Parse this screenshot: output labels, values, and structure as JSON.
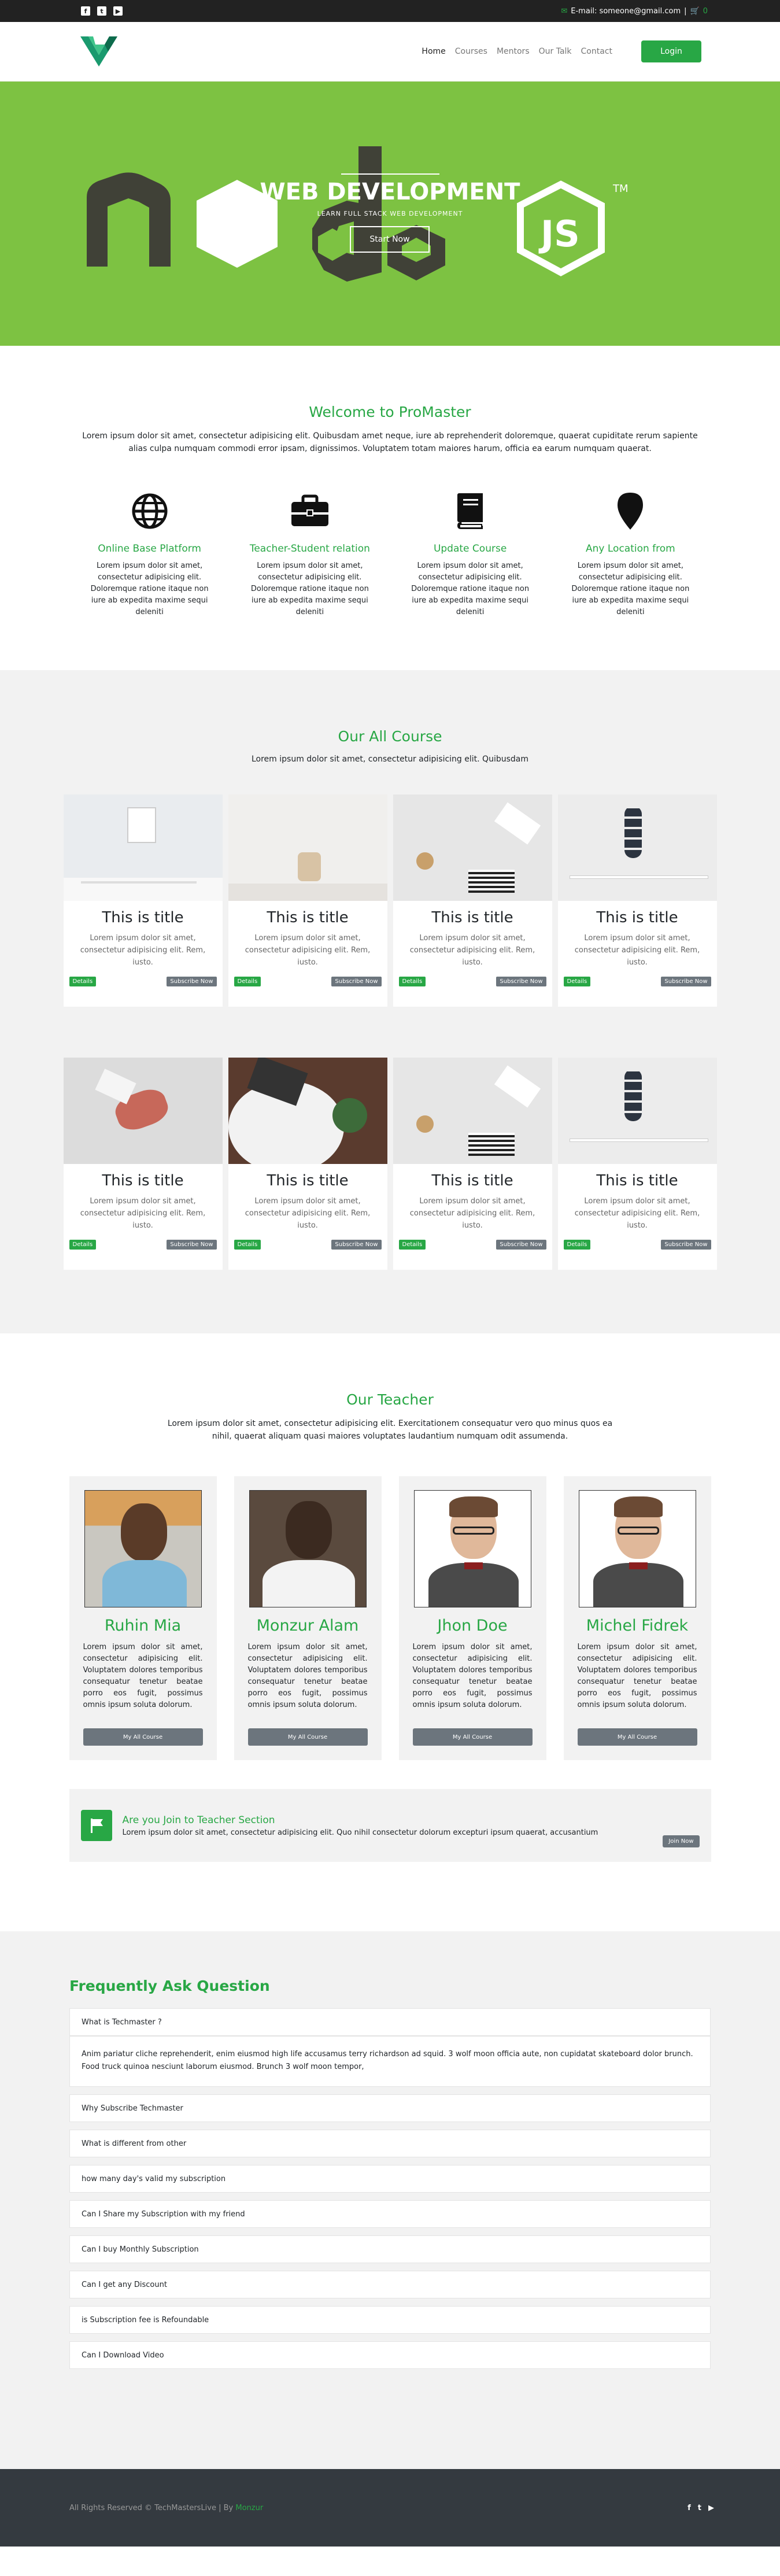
{
  "topbar": {
    "social_icons": [
      "facebook-icon",
      "twitter-icon",
      "youtube-icon"
    ],
    "email_label": "E-mail: someone@gmail.com",
    "separator": "|",
    "cart_count": "0"
  },
  "nav": {
    "items": [
      "Home",
      "Courses",
      "Mentors",
      "Our Talk",
      "Contact"
    ],
    "login": "Login"
  },
  "hero": {
    "title": "WEB DEVELOPMENT",
    "subtitle": "LEARN FULL STACK WEB DEVELOPMENT",
    "button": "Start Now",
    "tm": "TM"
  },
  "welcome": {
    "title": "Welcome to ProMaster",
    "text": "Lorem ipsum dolor sit amet, consectetur adipisicing elit. Quibusdam amet neque, iure ab reprehenderit doloremque, quaerat cupiditate rerum sapiente alias culpa numquam commodi error ipsam, dignissimos. Voluptatem totam maiores harum, officia ea earum numquam quaerat.",
    "features": [
      {
        "icon": "globe-icon",
        "title": "Online Base Platform",
        "text": "Lorem ipsum dolor sit amet, consectetur adipisicing elit. Doloremque ratione itaque non iure ab expedita maxime sequi deleniti"
      },
      {
        "icon": "briefcase-icon",
        "title": "Teacher-Student relation",
        "text": "Lorem ipsum dolor sit amet, consectetur adipisicing elit. Doloremque ratione itaque non iure ab expedita maxime sequi deleniti"
      },
      {
        "icon": "book-icon",
        "title": "Update Course",
        "text": "Lorem ipsum dolor sit amet, consectetur adipisicing elit. Doloremque ratione itaque non iure ab expedita maxime sequi deleniti"
      },
      {
        "icon": "map-marker-icon",
        "title": "Any Location from",
        "text": "Lorem ipsum dolor sit amet, consectetur adipisicing elit. Doloremque ratione itaque non iure ab expedita maxime sequi deleniti"
      }
    ]
  },
  "courses": {
    "title": "Our All Course",
    "text": "Lorem ipsum dolor sit amet, consectetur adipisicing elit. Quibusdam",
    "cards": [
      {
        "title": "This is title",
        "text": "Lorem ipsum dolor sit amet, consectetur adipisicing elit. Rem, iusto.",
        "details": "Details",
        "subscribe": "Subscribe Now"
      },
      {
        "title": "This is title",
        "text": "Lorem ipsum dolor sit amet, consectetur adipisicing elit. Rem, iusto.",
        "details": "Details",
        "subscribe": "Subscribe Now"
      },
      {
        "title": "This is title",
        "text": "Lorem ipsum dolor sit amet, consectetur adipisicing elit. Rem, iusto.",
        "details": "Details",
        "subscribe": "Subscribe Now"
      },
      {
        "title": "This is title",
        "text": "Lorem ipsum dolor sit amet, consectetur adipisicing elit. Rem, iusto.",
        "details": "Details",
        "subscribe": "Subscribe Now"
      },
      {
        "title": "This is title",
        "text": "Lorem ipsum dolor sit amet, consectetur adipisicing elit. Rem, iusto.",
        "details": "Details",
        "subscribe": "Subscribe Now"
      },
      {
        "title": "This is title",
        "text": "Lorem ipsum dolor sit amet, consectetur adipisicing elit. Rem, iusto.",
        "details": "Details",
        "subscribe": "Subscribe Now"
      },
      {
        "title": "This is title",
        "text": "Lorem ipsum dolor sit amet, consectetur adipisicing elit. Rem, iusto.",
        "details": "Details",
        "subscribe": "Subscribe Now"
      },
      {
        "title": "This is title",
        "text": "Lorem ipsum dolor sit amet, consectetur adipisicing elit. Rem, iusto.",
        "details": "Details",
        "subscribe": "Subscribe Now"
      }
    ]
  },
  "teachers": {
    "title": "Our Teacher",
    "text": "Lorem ipsum dolor sit amet, consectetur adipisicing elit. Exercitationem consequatur vero quo minus quos ea nihil, quaerat aliquam quasi maiores voluptates laudantium numquam odit assumenda.",
    "cards": [
      {
        "name": "Ruhin Mia",
        "text": "Lorem ipsum dolor sit amet, consectetur adipisicing elit. Voluptatem dolores temporibus consequatur tenetur beatae porro eos fugit, possimus omnis ipsum soluta dolorum.",
        "button": "My All Course"
      },
      {
        "name": "Monzur Alam",
        "text": "Lorem ipsum dolor sit amet, consectetur adipisicing elit. Voluptatem dolores temporibus consequatur tenetur beatae porro eos fugit, possimus omnis ipsum soluta dolorum.",
        "button": "My All Course"
      },
      {
        "name": "Jhon Doe",
        "text": "Lorem ipsum dolor sit amet, consectetur adipisicing elit. Voluptatem dolores temporibus consequatur tenetur beatae porro eos fugit, possimus omnis ipsum soluta dolorum.",
        "button": "My All Course"
      },
      {
        "name": "Michel Fidrek",
        "text": "Lorem ipsum dolor sit amet, consectetur adipisicing elit. Voluptatem dolores temporibus consequatur tenetur beatae porro eos fugit, possimus omnis ipsum soluta dolorum.",
        "button": "My All Course"
      }
    ],
    "join": {
      "title": "Are you Join to Teacher Section",
      "text": "Lorem ipsum dolor sit amet, consectetur adipisicing elit. Quo nihil consectetur dolorum excepturi ipsum quaerat, accusantium",
      "button": "Join Now"
    }
  },
  "faq": {
    "title": "Frequently Ask Question",
    "open_question": "What is Techmaster ?",
    "open_answer": "Anim pariatur cliche reprehenderit, enim eiusmod high life accusamus terry richardson ad squid. 3 wolf moon officia aute, non cupidatat skateboard dolor brunch. Food truck quinoa nesciunt laborum eiusmod. Brunch 3 wolf moon tempor,",
    "questions": [
      "Why Subscribe Techmaster",
      "What is different from other",
      "how many day's valid my subscription",
      "Can I Share my Subscription with my friend",
      "Can I buy Monthly Subscription",
      "Can I get any Discount",
      "is Subscription fee is Refoundable",
      "Can I Download Video"
    ]
  },
  "footer": {
    "copyright": "All Rights Reserved © TechMastersLive | By",
    "author": "Monzur",
    "social_icons": [
      "facebook-icon",
      "twitter-icon",
      "youtube-icon"
    ]
  },
  "colors": {
    "accent": "#28a745",
    "hero_bg": "#7dc242",
    "topbar_bg": "#222222",
    "footer_bg": "#343a40"
  }
}
